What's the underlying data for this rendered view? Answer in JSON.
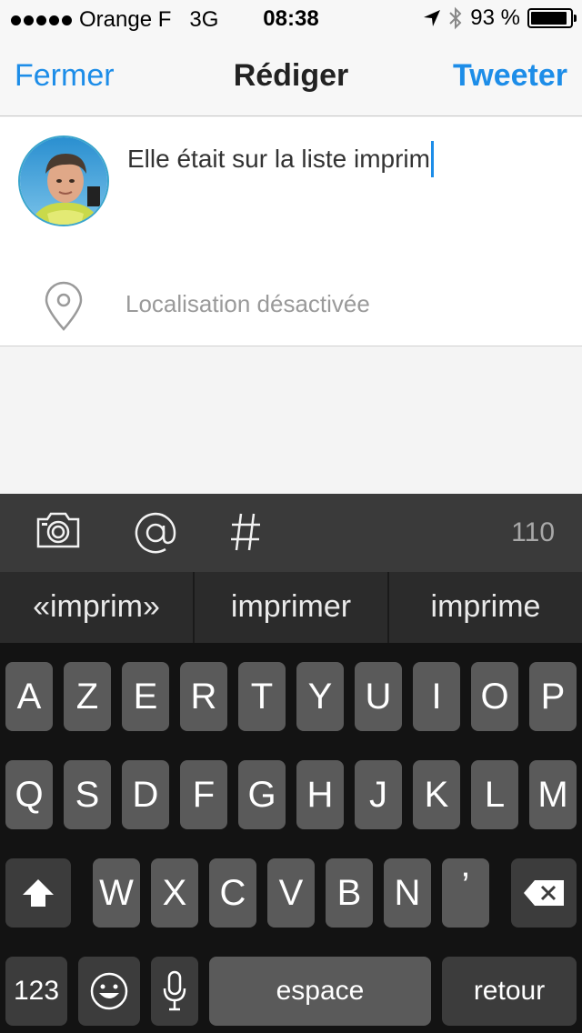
{
  "status_bar": {
    "carrier": "Orange F",
    "network": "3G",
    "time": "08:38",
    "battery": "93 %",
    "battery_level": 0.93
  },
  "nav": {
    "left": "Fermer",
    "title": "Rédiger",
    "right": "Tweeter"
  },
  "compose": {
    "text": "Elle était sur la liste imprim",
    "location": "Localisation désactivée"
  },
  "toolbar": {
    "counter": "110",
    "icons": [
      "camera-icon",
      "at-icon",
      "hashtag-icon"
    ]
  },
  "suggestions": [
    "«imprim»",
    "imprimer",
    "imprime"
  ],
  "keyboard": {
    "row1": [
      "A",
      "Z",
      "E",
      "R",
      "T",
      "Y",
      "U",
      "I",
      "O",
      "P"
    ],
    "row2": [
      "Q",
      "S",
      "D",
      "F",
      "G",
      "H",
      "J",
      "K",
      "L",
      "M"
    ],
    "row3": [
      "W",
      "X",
      "C",
      "V",
      "B",
      "N",
      "’"
    ],
    "numbers": "123",
    "space": "espace",
    "return": "retour"
  },
  "colors": {
    "accent": "#1d8de8",
    "keyboard_bg": "#131313",
    "key": "#5a5a5a",
    "key_dark": "#3c3c3c"
  }
}
